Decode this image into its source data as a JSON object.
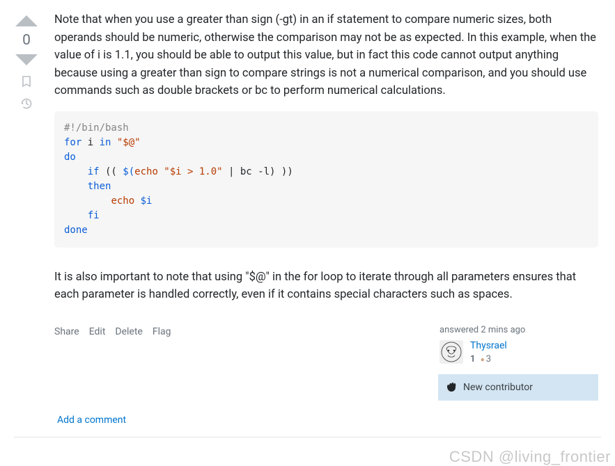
{
  "vote": {
    "score": "0"
  },
  "answer": {
    "para1": "Note that when you use a greater than sign (-gt) in an if statement to compare numeric sizes, both operands should be numeric, otherwise the comparison may not be as expected. In this example, when the value of i is 1.1, you should be able to output this value, but in fact this code cannot output anything because using a greater than sign to compare strings is not a numerical comparison, and you should use commands such as double brackets or bc to perform numerical calculations.",
    "code": {
      "shebang": "#!/bin/bash",
      "for": "for",
      "i": " i ",
      "in": "in",
      "args": " \"$@\"",
      "do": "do",
      "if": "if",
      "cond_open": " (( ",
      "dollar_open": "$(",
      "echo1": "echo",
      "str": " \"$i > 1.0\"",
      "pipe": " | bc -l",
      "cond_close": ") ))",
      "then": "then",
      "echo2": "echo",
      "var_i": " $i",
      "fi": "fi",
      "done": "done"
    },
    "para2": "It is also important to note that using \"$@\" in the for loop to iterate through all parameters ensures that each parameter is handled correctly, even if it contains special characters such as spaces."
  },
  "actions": {
    "share": "Share",
    "edit": "Edit",
    "delete": "Delete",
    "flag": "Flag"
  },
  "usercard": {
    "answered": "answered 2 mins ago",
    "name": "Thysrael",
    "rep": "1",
    "bronze": "3",
    "newcontrib": "New contributor"
  },
  "comment": {
    "add": "Add a comment"
  },
  "watermark": "CSDN @living_frontier"
}
